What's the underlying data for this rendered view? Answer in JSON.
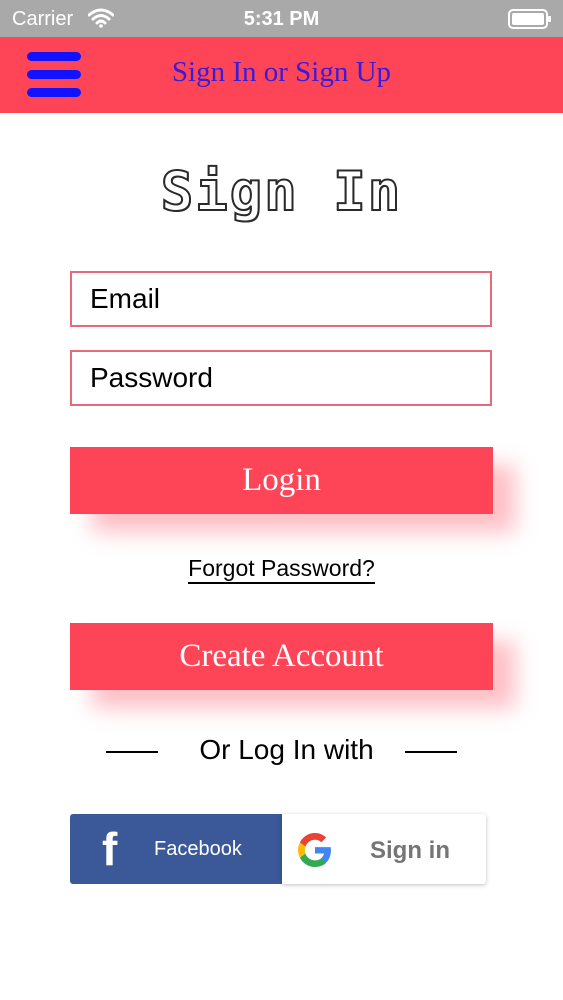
{
  "status_bar": {
    "carrier": "Carrier",
    "time": "5:31 PM",
    "wifi_icon": "wifi-icon",
    "battery_icon": "battery-icon"
  },
  "header": {
    "title": "Sign In or Sign Up",
    "menu_icon": "hamburger-menu-icon",
    "background_color": "#fe4558",
    "title_color": "#3a1bd6"
  },
  "page": {
    "title": "Sign In"
  },
  "form": {
    "email_placeholder": "Email",
    "password_placeholder": "Password",
    "login_label": "Login",
    "forgot_label": "Forgot Password?",
    "create_account_label": "Create Account"
  },
  "social": {
    "divider_text": "Or Log In with",
    "facebook_label": "Facebook",
    "facebook_icon": "facebook-icon",
    "facebook_color": "#3b5998",
    "google_label": "Sign in",
    "google_icon": "google-icon"
  },
  "colors": {
    "accent": "#fe4558",
    "input_border": "#e56b7a"
  }
}
